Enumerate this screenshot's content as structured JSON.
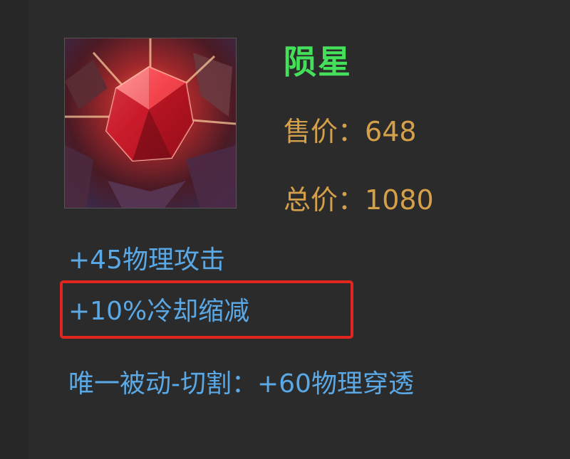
{
  "item": {
    "name": "陨星",
    "icon": "meteor-gem-icon",
    "sell_price_label": "售价：",
    "sell_price": "648",
    "total_price_label": "总价：",
    "total_price": "1080"
  },
  "stats": {
    "attack": "+45物理攻击",
    "cooldown": "+10%冷却缩减",
    "passive": "唯一被动-切割：+60物理穿透"
  },
  "colors": {
    "background": "#2b2b2b",
    "name": "#44e05a",
    "price": "#d5a04a",
    "stat": "#5aa9e6",
    "highlight": "#e0261e"
  }
}
